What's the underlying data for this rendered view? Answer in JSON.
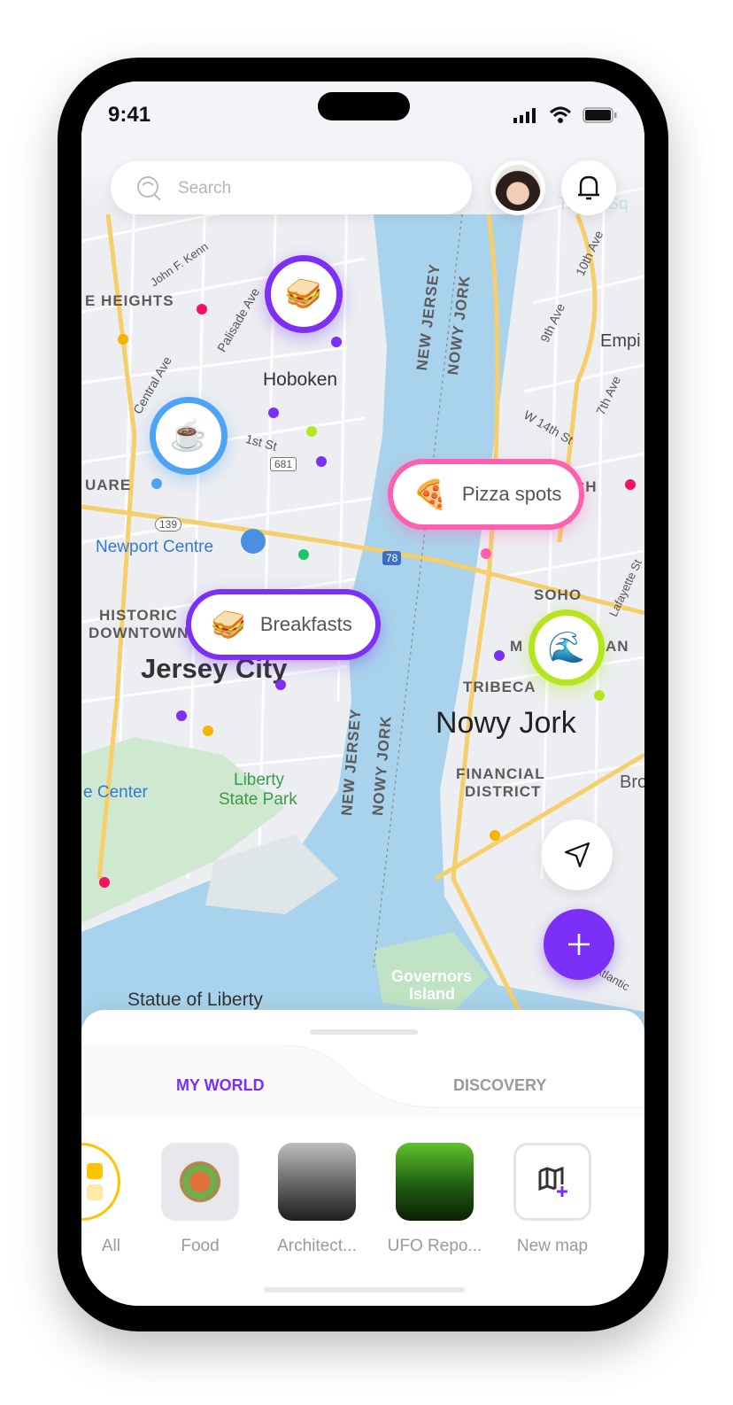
{
  "status_bar": {
    "time": "9:41",
    "icons": [
      "signal-icon",
      "wifi-icon",
      "battery-icon"
    ]
  },
  "search": {
    "placeholder": "Search",
    "icon": "search-icon"
  },
  "header": {
    "avatar": "user-avatar",
    "notifications_icon": "bell-icon"
  },
  "map": {
    "labels": {
      "heights": "E HEIGHTS",
      "jfk": "John F. Kenn",
      "palisade": "Palisade Ave",
      "central": "Central Ave",
      "hoboken": "Hoboken",
      "first_st": "1st St",
      "route681": "681",
      "square": "UARE",
      "route139": "139",
      "newport": "Newport Centre",
      "historic": "HISTORIC",
      "downtown": "DOWNTOWN",
      "jersey_city": "Jersey City",
      "liberty_park_1": "Liberty",
      "liberty_park_2": "State Park",
      "center": "e Center",
      "statue": "Statue of Liberty",
      "governors_1": "Governors",
      "governors_2": "Island",
      "nj_1": "NEW JERSEY",
      "ny_1": "NOWY JORK",
      "nj_2": "NEW JERSEY",
      "ny_2": "NOWY JORK",
      "times_sq": "Times Sq",
      "tenth_ave": "10th Ave",
      "ninth_ave": "9th Ave",
      "seventh_ave": "7th Ave",
      "w14": "W 14th St",
      "empire": "Empi",
      "ch": "CH",
      "soho": "SOHO",
      "manhattan_m": "M",
      "manhattan_an": "AN",
      "lafayette": "Lafayette St",
      "tribeca": "TRIBECA",
      "nowy_jork": "Nowy Jork",
      "financial_1": "FINANCIAL",
      "financial_2": "DISTRICT",
      "brooklyn": "Bro",
      "atlantic": "Atlantic",
      "route78": "78"
    },
    "markers": [
      {
        "kind": "circle",
        "icon": "sandwich-icon",
        "emoji": "🥪",
        "color": "#7B2FF7"
      },
      {
        "kind": "circle",
        "icon": "coffee-icon",
        "emoji": "☕",
        "color": "#4DA3F5"
      },
      {
        "kind": "pill",
        "icon": "pizza-icon",
        "emoji": "🍕",
        "label": "Pizza spots",
        "color": "#FF5FB0"
      },
      {
        "kind": "pill",
        "icon": "sandwich-icon",
        "emoji": "🥪",
        "label": "Breakfasts",
        "color": "#7B2FF7"
      },
      {
        "kind": "circle",
        "icon": "wave-icon",
        "emoji": "🌊",
        "color": "#B5E61D"
      }
    ]
  },
  "fab": {
    "navigate_icon": "navigation-arrow-icon",
    "add_icon": "plus-icon",
    "accent": "#7B2FF7"
  },
  "sheet": {
    "tabs": [
      {
        "label": "MY WORLD",
        "active": true
      },
      {
        "label": "DISCOVERY",
        "active": false
      }
    ],
    "maps": [
      {
        "label": "All"
      },
      {
        "label": "Food"
      },
      {
        "label": "Architect..."
      },
      {
        "label": "UFO Repo..."
      },
      {
        "label": "New map"
      }
    ]
  }
}
